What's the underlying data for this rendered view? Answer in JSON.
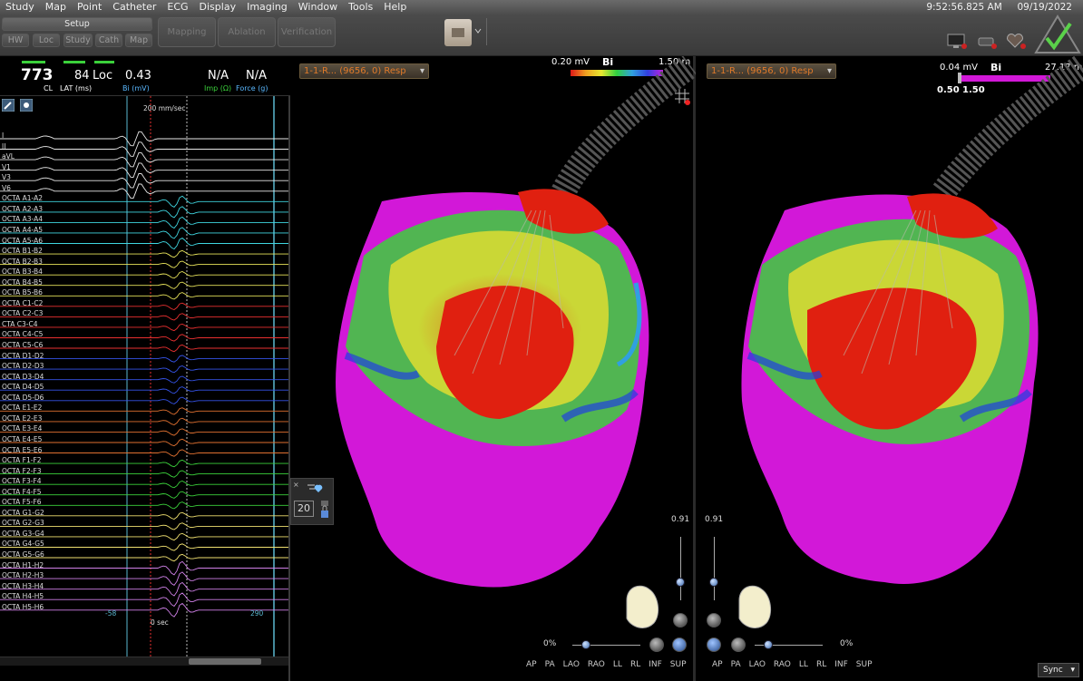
{
  "menu": [
    "Study",
    "Map",
    "Point",
    "Catheter",
    "ECG",
    "Display",
    "Imaging",
    "Window",
    "Tools",
    "Help"
  ],
  "clock": {
    "time": "9:52:56.825 AM",
    "date": "09/19/2022"
  },
  "toolbar": {
    "setup_label": "Setup",
    "sub_buttons": [
      "HW",
      "Loc",
      "Study",
      "Cath",
      "Map"
    ],
    "workflow_buttons": [
      "Mapping",
      "Ablation",
      "Verification"
    ],
    "status_icons": [
      "monitor-icon",
      "catheter-status-icon",
      "heart-status-icon",
      "checkmark-triangle-icon"
    ]
  },
  "ecg_header": {
    "cl_value": "773",
    "cl_label": "CL",
    "lat_value": "84",
    "lat_label": "LAT (ms)",
    "loc_label": "Loc",
    "bi_value": "0.43",
    "bi_label": "Bi (mV)",
    "imp_value": "N/A",
    "imp_label": "Imp (Ω)",
    "force_value": "N/A",
    "force_label": "Force (g)"
  },
  "ecg": {
    "sweep_speed": "200 mm/sec",
    "zero_label": "0 sec",
    "left_marker": "-58",
    "right_marker": "290",
    "leads": [
      "I",
      "II",
      "aVL",
      "V1",
      "V3",
      "V6",
      "OCTA A1-A2",
      "OCTA A2-A3",
      "OCTA A3-A4",
      "OCTA A4-A5",
      "OCTA A5-A6",
      "OCTA B1-B2",
      "OCTA B2-B3",
      "OCTA B3-B4",
      "OCTA B4-B5",
      "OCTA B5-B6",
      "OCTA C1-C2",
      "OCTA C2-C3",
      "CTA C3-C4",
      "OCTA C4-C5",
      "OCTA C5-C6",
      "OCTA D1-D2",
      "OCTA D2-D3",
      "OCTA D3-D4",
      "OCTA D4-D5",
      "OCTA D5-D6",
      "OCTA E1-E2",
      "OCTA E2-E3",
      "OCTA E3-E4",
      "OCTA E4-E5",
      "OCTA E5-E6",
      "OCTA F1-F2",
      "OCTA F2-F3",
      "OCTA F3-F4",
      "OCTA F4-F5",
      "OCTA F5-F6",
      "OCTA G1-G2",
      "OCTA G2-G3",
      "OCTA G3-G4",
      "OCTA G4-G5",
      "OCTA G5-G6",
      "OCTA H1-H2",
      "OCTA H2-H3",
      "OCTA H3-H4",
      "OCTA H4-H5",
      "OCTA H5-H6"
    ],
    "lead_colors": [
      "#e8e8e8",
      "#e8e8e8",
      "#e8e8e8",
      "#e8e8e8",
      "#e8e8e8",
      "#e8e8e8",
      "#3fd6e0",
      "#3fd6e0",
      "#3fd6e0",
      "#3fd6e0",
      "#3fd6e0",
      "#e6e25a",
      "#e6e25a",
      "#e6e25a",
      "#e6e25a",
      "#e6e25a",
      "#e83030",
      "#e83030",
      "#e83030",
      "#e83030",
      "#e83030",
      "#3553e8",
      "#3553e8",
      "#3553e8",
      "#3553e8",
      "#3553e8",
      "#e07030",
      "#e07030",
      "#e07030",
      "#e07030",
      "#e07030",
      "#3bd13b",
      "#3bd13b",
      "#3bd13b",
      "#3bd13b",
      "#3bd13b",
      "#f0e070",
      "#f0e070",
      "#f0e070",
      "#f0e070",
      "#f0e070",
      "#d080e8",
      "#d080e8",
      "#d080e8",
      "#d080e8",
      "#d080e8"
    ]
  },
  "map1": {
    "dropdown": "1-1-R... (9656, 0) Resp",
    "bar_min": "0.20 mV",
    "bar_title": "Bi",
    "bar_max": "1.50 m",
    "zoom_value": "0.91",
    "rotate_pct": "0%"
  },
  "map2": {
    "dropdown": "1-1-R... (9656, 0) Resp",
    "bar_min": "0.04 mV",
    "bar_title": "Bi",
    "bar_max": "27.17 m",
    "threshold_low": "0.50",
    "threshold_high": "1.50",
    "zoom_value": "0.91",
    "rotate_pct": "0%"
  },
  "view_buttons": [
    "AP",
    "PA",
    "LAO",
    "RAO",
    "LL",
    "RL",
    "INF",
    "SUP"
  ],
  "point_count": "20",
  "sync_label": "Sync",
  "colors": {
    "accent_orange": "#e07a2a",
    "toolbar_bg": "#444444",
    "magenta": "#d218d8"
  }
}
